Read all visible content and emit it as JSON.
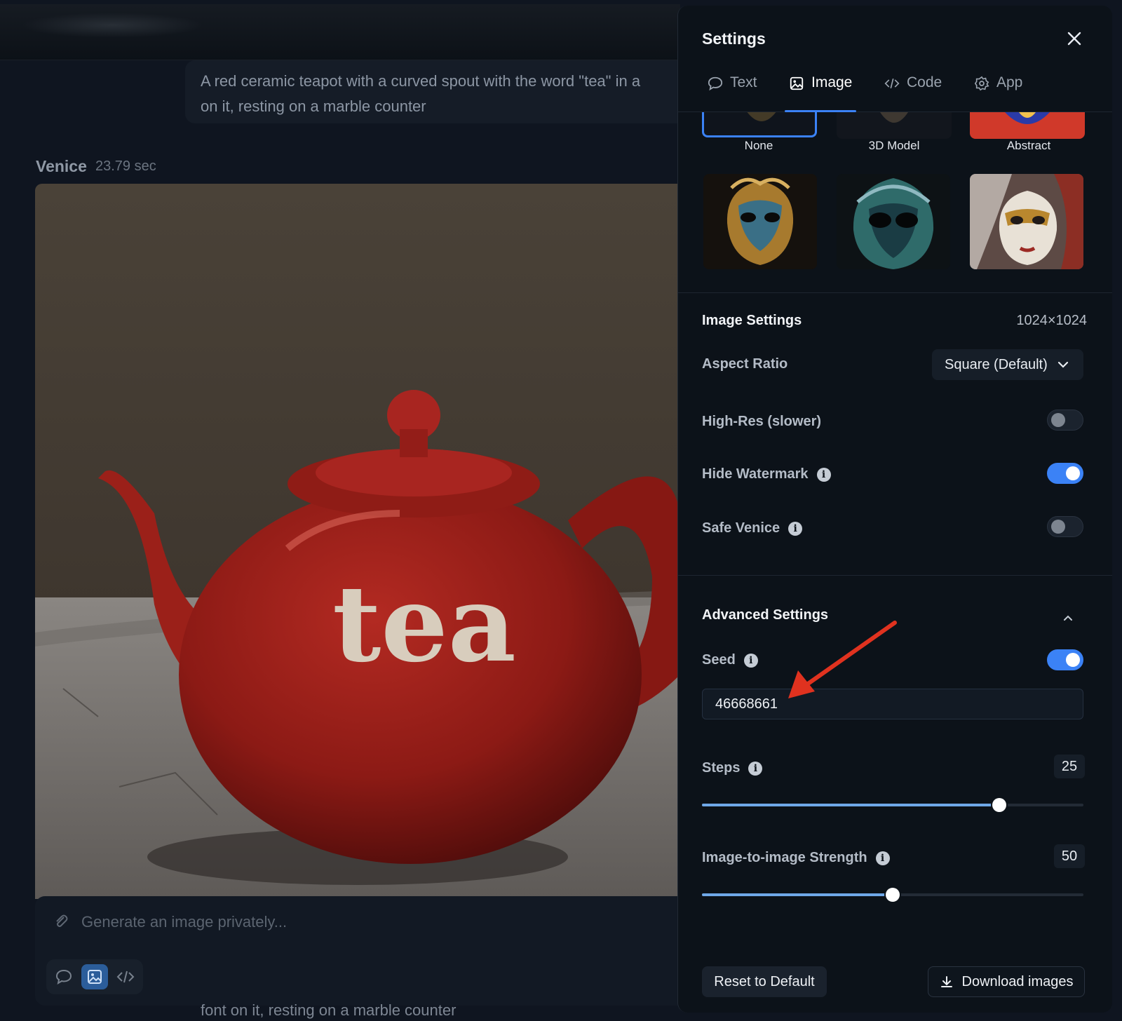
{
  "chat": {
    "prompt": "A red ceramic teapot with a curved spout with the word \"tea\" in a font on it, resting on a marble counter",
    "prompt_line1": "A red ceramic teapot with a curved spout with the word \"tea\" in a",
    "prompt_line2": "on it, resting on a marble counter",
    "assistant_name": "Venice",
    "response_time": "23.79 sec",
    "image_word": "tea",
    "composer_placeholder": "Generate an image privately...",
    "bottom_text": "font on it, resting on a marble counter"
  },
  "settings": {
    "title": "Settings",
    "tabs": [
      {
        "label": "Text",
        "icon": "chat-bubble-icon",
        "active": false
      },
      {
        "label": "Image",
        "icon": "image-icon",
        "active": true
      },
      {
        "label": "Code",
        "icon": "code-icon",
        "active": false
      },
      {
        "label": "App",
        "icon": "gear-icon",
        "active": false
      }
    ],
    "styles": [
      {
        "label": "None",
        "selected": true
      },
      {
        "label": "3D Model",
        "selected": false
      },
      {
        "label": "Abstract",
        "selected": false
      }
    ],
    "image_settings": {
      "title": "Image Settings",
      "resolution": "1024×1024",
      "aspect_ratio_label": "Aspect Ratio",
      "aspect_ratio_value": "Square (Default)",
      "high_res_label": "High-Res (slower)",
      "high_res_on": false,
      "hide_watermark_label": "Hide Watermark",
      "hide_watermark_on": true,
      "safe_venice_label": "Safe Venice",
      "safe_venice_on": false
    },
    "advanced": {
      "title": "Advanced Settings",
      "seed_label": "Seed",
      "seed_on": true,
      "seed_value": "46668661",
      "steps_label": "Steps",
      "steps_value": "25",
      "steps_fraction": 0.78,
      "strength_label": "Image-to-image Strength",
      "strength_value": "50",
      "strength_fraction": 0.5
    },
    "footer": {
      "reset_label": "Reset to Default",
      "download_label": "Download images"
    }
  },
  "colors": {
    "accent": "#3b82f6",
    "annotation_arrow": "#e0321f"
  }
}
